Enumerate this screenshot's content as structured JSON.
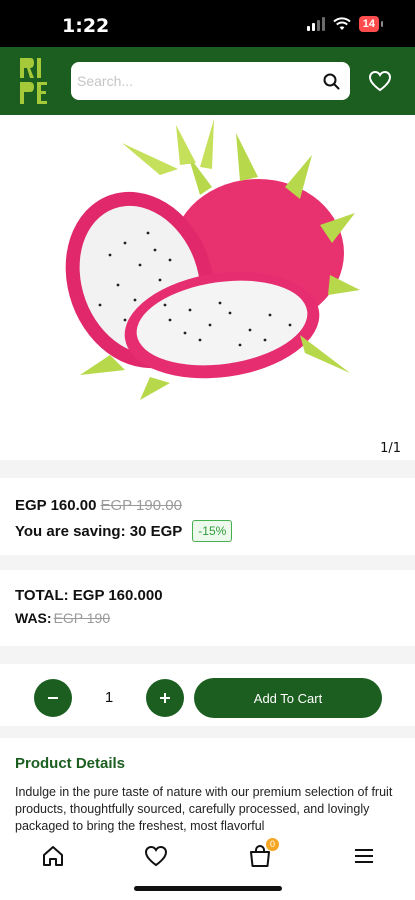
{
  "status_bar": {
    "time": "1:22",
    "battery": "14"
  },
  "header": {
    "logo_alt": "RIPE",
    "search": {
      "placeholder": "Search...",
      "value": ""
    }
  },
  "product": {
    "image_description": "dragon fruit halves",
    "pager": "1/1",
    "currency": "EGP",
    "price": "EGP 160.00",
    "old_price": "EGP 190.00",
    "saving_label": "You are saving: 30 EGP",
    "discount": "-15%",
    "total": "TOTAL: EGP 160.000",
    "was_label": "WAS:",
    "was_price": "EGP 190"
  },
  "quantity": {
    "value": "1"
  },
  "actions": {
    "add_to_cart": "Add To Cart"
  },
  "details": {
    "title": "Product Details",
    "text": "Indulge in the pure taste of nature with our premium selection of fruit products, thoughtfully sourced, carefully processed, and lovingly packaged to bring the freshest, most flavorful"
  },
  "bottom_nav": {
    "cart_count": "0"
  },
  "colors": {
    "brand_green": "#1b5e20",
    "badge_green": "#2f9b39",
    "cart_badge": "#f5a623"
  }
}
